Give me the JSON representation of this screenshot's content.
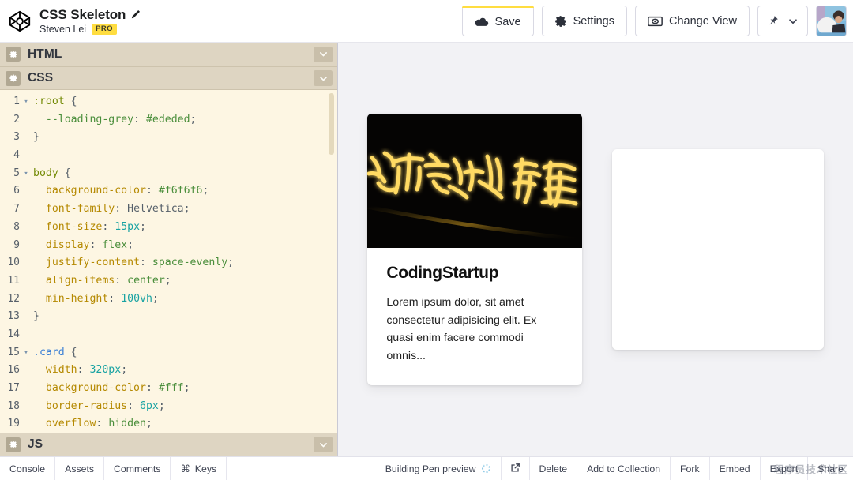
{
  "header": {
    "logo_icon": "cube-icon",
    "pen_title": "CSS Skeleton",
    "edit_icon": "pencil-icon",
    "author": "Steven Lei",
    "pro_badge": "PRO",
    "buttons": {
      "save": {
        "label": "Save",
        "icon": "cloud-icon",
        "accent": "#ffdd40"
      },
      "settings": {
        "label": "Settings",
        "icon": "gear-icon"
      },
      "change_view": {
        "label": "Change View",
        "icon": "view-icon"
      },
      "pin": {
        "icon": "pin-icon",
        "chevron": "chevron-down-icon"
      }
    },
    "avatar": "user-avatar"
  },
  "editors": {
    "panels": [
      {
        "label": "HTML",
        "gear": "gear-icon",
        "chevron": "chevron-down-icon"
      },
      {
        "label": "CSS",
        "gear": "gear-icon",
        "chevron": "chevron-down-icon"
      },
      {
        "label": "JS",
        "gear": "gear-icon",
        "chevron": "chevron-down-icon"
      }
    ],
    "active_panel": "CSS",
    "code_lines": [
      {
        "n": "1",
        "fold": "▾",
        "tokens": [
          {
            "t": "sel",
            "v": ":root"
          },
          {
            "t": "punc",
            "v": " {"
          }
        ]
      },
      {
        "n": "2",
        "fold": "",
        "tokens": [
          {
            "t": "punc",
            "v": "  "
          },
          {
            "t": "var",
            "v": "--loading-grey"
          },
          {
            "t": "punc",
            "v": ": "
          },
          {
            "t": "val",
            "v": "#ededed"
          },
          {
            "t": "punc",
            "v": ";"
          }
        ]
      },
      {
        "n": "3",
        "fold": "",
        "tokens": [
          {
            "t": "punc",
            "v": "}"
          }
        ]
      },
      {
        "n": "4",
        "fold": "",
        "tokens": []
      },
      {
        "n": "5",
        "fold": "▾",
        "tokens": [
          {
            "t": "sel",
            "v": "body"
          },
          {
            "t": "punc",
            "v": " {"
          }
        ]
      },
      {
        "n": "6",
        "fold": "",
        "tokens": [
          {
            "t": "punc",
            "v": "  "
          },
          {
            "t": "prop",
            "v": "background-color"
          },
          {
            "t": "punc",
            "v": ": "
          },
          {
            "t": "val",
            "v": "#f6f6f6"
          },
          {
            "t": "punc",
            "v": ";"
          }
        ]
      },
      {
        "n": "7",
        "fold": "",
        "tokens": [
          {
            "t": "punc",
            "v": "  "
          },
          {
            "t": "prop",
            "v": "font-family"
          },
          {
            "t": "punc",
            "v": ": "
          },
          {
            "t": "punc",
            "v": "Helvetica"
          },
          {
            "t": "punc",
            "v": ";"
          }
        ]
      },
      {
        "n": "8",
        "fold": "",
        "tokens": [
          {
            "t": "punc",
            "v": "  "
          },
          {
            "t": "prop",
            "v": "font-size"
          },
          {
            "t": "punc",
            "v": ": "
          },
          {
            "t": "num",
            "v": "15px"
          },
          {
            "t": "punc",
            "v": ";"
          }
        ]
      },
      {
        "n": "9",
        "fold": "",
        "tokens": [
          {
            "t": "punc",
            "v": "  "
          },
          {
            "t": "prop",
            "v": "display"
          },
          {
            "t": "punc",
            "v": ": "
          },
          {
            "t": "val",
            "v": "flex"
          },
          {
            "t": "punc",
            "v": ";"
          }
        ]
      },
      {
        "n": "10",
        "fold": "",
        "tokens": [
          {
            "t": "punc",
            "v": "  "
          },
          {
            "t": "prop",
            "v": "justify-content"
          },
          {
            "t": "punc",
            "v": ": "
          },
          {
            "t": "val",
            "v": "space-evenly"
          },
          {
            "t": "punc",
            "v": ";"
          }
        ]
      },
      {
        "n": "11",
        "fold": "",
        "tokens": [
          {
            "t": "punc",
            "v": "  "
          },
          {
            "t": "prop",
            "v": "align-items"
          },
          {
            "t": "punc",
            "v": ": "
          },
          {
            "t": "val",
            "v": "center"
          },
          {
            "t": "punc",
            "v": ";"
          }
        ]
      },
      {
        "n": "12",
        "fold": "",
        "tokens": [
          {
            "t": "punc",
            "v": "  "
          },
          {
            "t": "prop",
            "v": "min-height"
          },
          {
            "t": "punc",
            "v": ": "
          },
          {
            "t": "num",
            "v": "100vh"
          },
          {
            "t": "punc",
            "v": ";"
          }
        ]
      },
      {
        "n": "13",
        "fold": "",
        "tokens": [
          {
            "t": "punc",
            "v": "}"
          }
        ]
      },
      {
        "n": "14",
        "fold": "",
        "tokens": []
      },
      {
        "n": "15",
        "fold": "▾",
        "tokens": [
          {
            "t": "selb",
            "v": ".card"
          },
          {
            "t": "punc",
            "v": " {"
          }
        ]
      },
      {
        "n": "16",
        "fold": "",
        "tokens": [
          {
            "t": "punc",
            "v": "  "
          },
          {
            "t": "prop",
            "v": "width"
          },
          {
            "t": "punc",
            "v": ": "
          },
          {
            "t": "num",
            "v": "320px"
          },
          {
            "t": "punc",
            "v": ";"
          }
        ]
      },
      {
        "n": "17",
        "fold": "",
        "tokens": [
          {
            "t": "punc",
            "v": "  "
          },
          {
            "t": "prop",
            "v": "background-color"
          },
          {
            "t": "punc",
            "v": ": "
          },
          {
            "t": "val",
            "v": "#fff"
          },
          {
            "t": "punc",
            "v": ";"
          }
        ]
      },
      {
        "n": "18",
        "fold": "",
        "tokens": [
          {
            "t": "punc",
            "v": "  "
          },
          {
            "t": "prop",
            "v": "border-radius"
          },
          {
            "t": "punc",
            "v": ": "
          },
          {
            "t": "num",
            "v": "6px"
          },
          {
            "t": "punc",
            "v": ";"
          }
        ]
      },
      {
        "n": "19",
        "fold": "",
        "tokens": [
          {
            "t": "punc",
            "v": "  "
          },
          {
            "t": "prop",
            "v": "overflow"
          },
          {
            "t": "punc",
            "v": ": "
          },
          {
            "t": "val",
            "v": "hidden"
          },
          {
            "t": "punc",
            "v": ";"
          }
        ]
      }
    ]
  },
  "preview": {
    "background": "#f2f2f5",
    "card": {
      "image_alt": "neon-calligraphy-photo",
      "title": "CodingStartup",
      "text": "Lorem ipsum dolor, sit amet consectetur adipisicing elit. Ex quasi enim facere commodi omnis..."
    },
    "skeleton_card": "empty-loading-card"
  },
  "bottombar": {
    "left_items": [
      {
        "label": "Console",
        "icon": ""
      },
      {
        "label": "Assets",
        "icon": ""
      },
      {
        "label": "Comments",
        "icon": ""
      },
      {
        "label": "Keys",
        "icon": "⌘"
      }
    ],
    "status": "Building Pen preview",
    "status_icon": "loading-spinner",
    "open_icon": "external-link-icon",
    "right_items": [
      {
        "label": "Delete"
      },
      {
        "label": "Add to Collection"
      },
      {
        "label": "Fork"
      },
      {
        "label": "Embed"
      },
      {
        "label": "Export"
      },
      {
        "label": "Share"
      }
    ],
    "watermark": "程序员技术社区"
  }
}
